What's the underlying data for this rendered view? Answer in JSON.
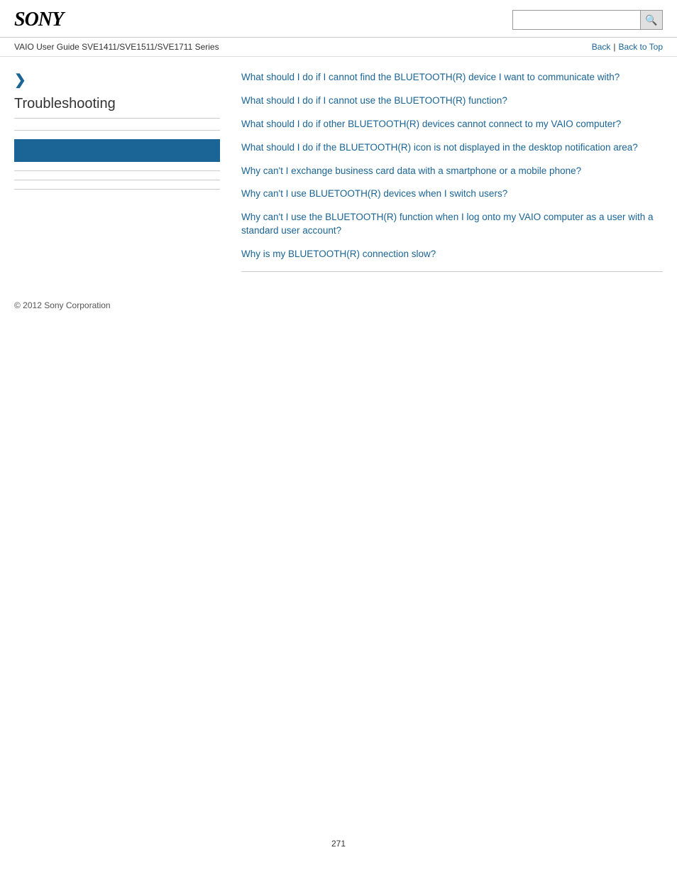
{
  "header": {
    "logo": "SONY",
    "search_placeholder": "",
    "search_button_icon": "🔍"
  },
  "nav": {
    "title": "VAIO User Guide SVE1411/SVE1511/SVE1711 Series",
    "back_label": "Back",
    "separator": "|",
    "back_to_top_label": "Back to Top"
  },
  "sidebar": {
    "arrow": "❯",
    "section_title": "Troubleshooting"
  },
  "content": {
    "links": [
      "What should I do if I cannot find the BLUETOOTH(R) device I want to communicate with?",
      "What should I do if I cannot use the BLUETOOTH(R) function?",
      "What should I do if other BLUETOOTH(R) devices cannot connect to my VAIO computer?",
      "What should I do if the BLUETOOTH(R) icon is not displayed in the desktop notification area?",
      "Why can't I exchange business card data with a smartphone or a mobile phone?",
      "Why can't I use BLUETOOTH(R) devices when I switch users?",
      "Why can't I use the BLUETOOTH(R) function when I log onto my VAIO computer as a user with a standard user account?",
      "Why is my BLUETOOTH(R) connection slow?"
    ]
  },
  "footer": {
    "copyright": "© 2012 Sony Corporation"
  },
  "page_number": "271"
}
